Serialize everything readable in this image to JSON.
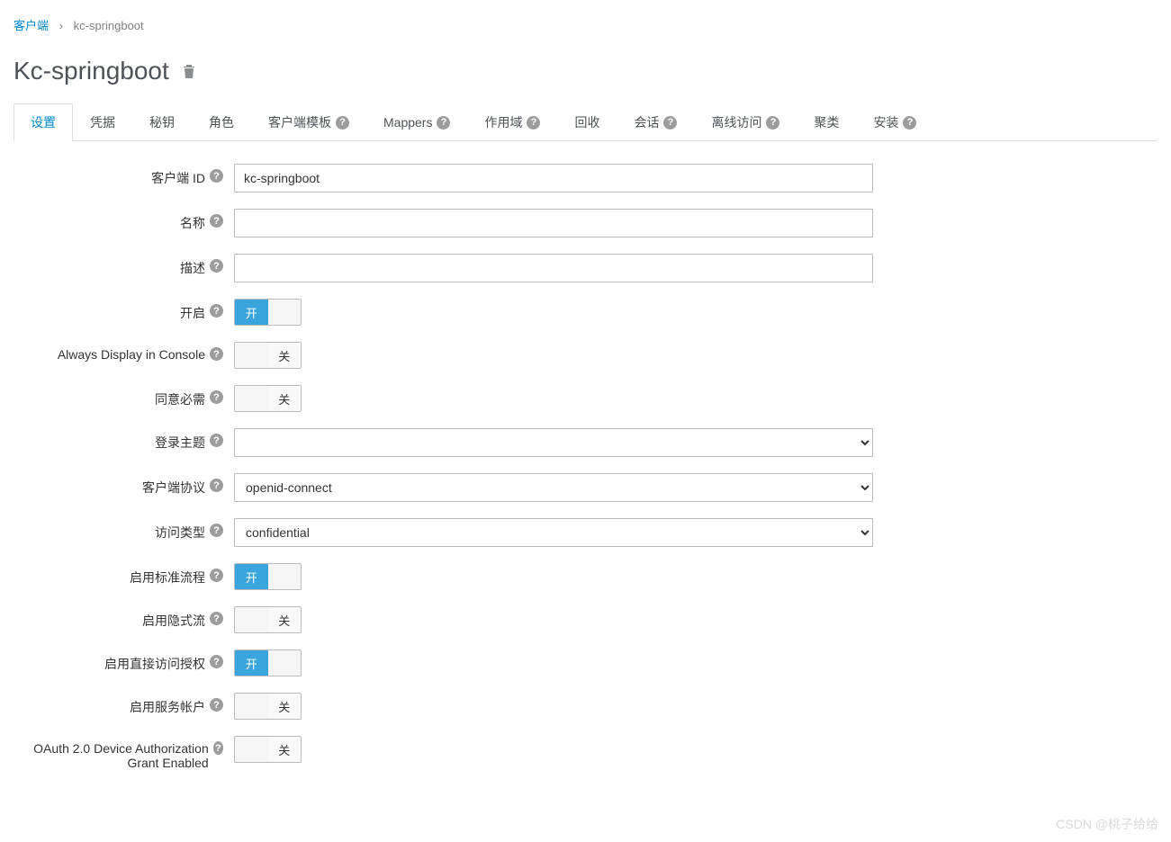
{
  "breadcrumb": {
    "parent": "客户端",
    "current": "kc-springboot"
  },
  "page_title": "Kc-springboot",
  "tabs": [
    {
      "label": "设置",
      "help": false,
      "active": true
    },
    {
      "label": "凭据",
      "help": false
    },
    {
      "label": "秘钥",
      "help": false
    },
    {
      "label": "角色",
      "help": false
    },
    {
      "label": "客户端模板",
      "help": true
    },
    {
      "label": "Mappers",
      "help": true
    },
    {
      "label": "作用域",
      "help": true
    },
    {
      "label": "回收",
      "help": false
    },
    {
      "label": "会话",
      "help": true
    },
    {
      "label": "离线访问",
      "help": true
    },
    {
      "label": "聚类",
      "help": false
    },
    {
      "label": "安装",
      "help": true
    }
  ],
  "toggle_labels": {
    "on": "开",
    "off": "关"
  },
  "fields": {
    "client_id": {
      "label": "客户端 ID",
      "value": "kc-springboot"
    },
    "name": {
      "label": "名称",
      "value": ""
    },
    "description": {
      "label": "描述",
      "value": ""
    },
    "enabled": {
      "label": "开启",
      "on": true
    },
    "always_display": {
      "label": "Always Display in Console",
      "on": false
    },
    "consent": {
      "label": "同意必需",
      "on": false
    },
    "login_theme": {
      "label": "登录主题",
      "value": ""
    },
    "protocol": {
      "label": "客户端协议",
      "value": "openid-connect"
    },
    "access_type": {
      "label": "访问类型",
      "value": "confidential"
    },
    "standard_flow": {
      "label": "启用标准流程",
      "on": true
    },
    "implicit_flow": {
      "label": "启用隐式流",
      "on": false
    },
    "direct_access": {
      "label": "启用直接访问授权",
      "on": true
    },
    "service_accounts": {
      "label": "启用服务帐户",
      "on": false
    },
    "oauth_device": {
      "label": "OAuth 2.0 Device Authorization Grant Enabled",
      "on": false
    }
  },
  "watermark": "CSDN @桃子给给"
}
